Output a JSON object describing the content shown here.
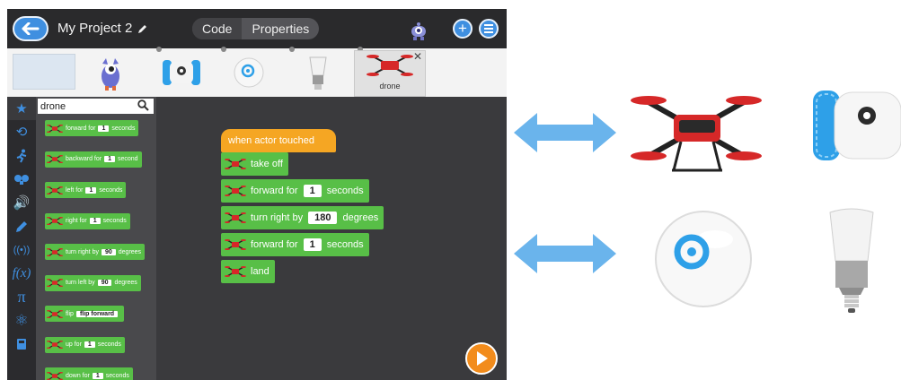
{
  "app": {
    "title": "My Project 2",
    "tabs": [
      {
        "label": "Code",
        "active": true
      },
      {
        "label": "Properties",
        "active": false
      }
    ],
    "accent": "#3f8fe0"
  },
  "actors": [
    {
      "name": "blank-stage"
    },
    {
      "name": "monster-character"
    },
    {
      "name": "ollie-robot"
    },
    {
      "name": "sphero-ball"
    },
    {
      "name": "smart-bulb"
    },
    {
      "name": "drone",
      "label": "drone",
      "selected": true
    }
  ],
  "sidebar": {
    "categories": [
      "star-icon",
      "repeat-icon",
      "motion-icon",
      "looks-icon",
      "sound-icon",
      "pen-icon",
      "signal-icon",
      "function-icon",
      "pi-icon",
      "atom-icon",
      "document-icon"
    ]
  },
  "palette": {
    "search_value": "drone",
    "blocks": [
      {
        "pre": "forward for",
        "val": "1",
        "post": "seconds"
      },
      {
        "pre": "backward for",
        "val": "1",
        "post": "second"
      },
      {
        "pre": "left for",
        "val": "1",
        "post": "seconds"
      },
      {
        "pre": "right for",
        "val": "1",
        "post": "seconds"
      },
      {
        "pre": "turn right by",
        "val": "90",
        "post": "degrees"
      },
      {
        "pre": "turn left by",
        "val": "90",
        "post": "degrees"
      },
      {
        "pre": "flip",
        "val": "flip forward",
        "post": ""
      },
      {
        "pre": "up for",
        "val": "1",
        "post": "seconds"
      },
      {
        "pre": "down for",
        "val": "1",
        "post": "seconds"
      }
    ]
  },
  "script": {
    "hat": "when actor touched",
    "blocks": [
      {
        "pre": "take off",
        "val": "",
        "post": ""
      },
      {
        "pre": "forward for",
        "val": "1",
        "post": "seconds"
      },
      {
        "pre": "turn right by",
        "val": "180",
        "post": "degrees"
      },
      {
        "pre": "forward for",
        "val": "1",
        "post": "seconds"
      },
      {
        "pre": "land",
        "val": "",
        "post": ""
      }
    ]
  },
  "devices": [
    {
      "name": "drone-device"
    },
    {
      "name": "ollie-device"
    },
    {
      "name": "sphero-device"
    },
    {
      "name": "smart-bulb-device"
    }
  ],
  "colors": {
    "arrow": "#6ab4ec",
    "block_green": "#58bf47",
    "hat_orange": "#f5a623",
    "play_orange": "#f28c1c"
  }
}
